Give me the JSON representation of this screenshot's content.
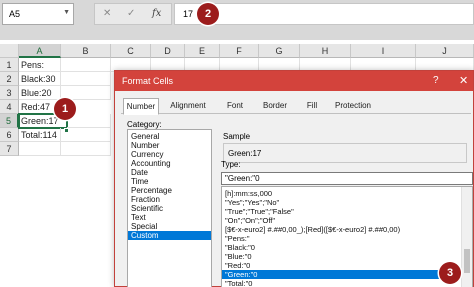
{
  "formula_bar": {
    "name_box": "A5",
    "name_box_arrow": "▼",
    "cancel_icon": "✕",
    "enter_icon": "✓",
    "function_icon": "fx",
    "content": "17"
  },
  "callouts": {
    "one": "1",
    "two": "2",
    "three": "3"
  },
  "sheet": {
    "columns": [
      "A",
      "B",
      "C",
      "D",
      "E",
      "F",
      "G",
      "H",
      "I",
      "J"
    ],
    "rows": [
      "1",
      "2",
      "3",
      "4",
      "5",
      "6",
      "7"
    ],
    "cells_col_a": [
      "Pens:",
      "Black:30",
      "Blue:20",
      "Red:47",
      "Green:17",
      "Total:114",
      ""
    ]
  },
  "dialog": {
    "title": "Format Cells",
    "help_icon": "?",
    "close_icon": "✕",
    "tabs": [
      "Number",
      "Alignment",
      "Font",
      "Border",
      "Fill",
      "Protection"
    ],
    "category_label": "Category:",
    "categories": [
      "General",
      "Number",
      "Currency",
      "Accounting",
      "Date",
      "Time",
      "Percentage",
      "Fraction",
      "Scientific",
      "Text",
      "Special",
      "Custom"
    ],
    "selected_category": "Custom",
    "sample_label": "Sample",
    "sample_value": "Green:17",
    "type_label": "Type:",
    "type_value": "\"Green:\"0",
    "type_list": [
      "[h]:mm:ss,000",
      "\"Yes\";\"Yes\";\"No\"",
      "\"True\";\"True\";\"False\"",
      "\"On\";\"On\";\"Off\"",
      "[$€-x-euro2] #.##0,00_);[Red]([$€-x-euro2] #.##0,00)",
      "\"Pens:\"",
      "\"Black:\"0",
      "\"Blue:\"0",
      "\"Red:\"0",
      "\"Green:\"0",
      "\"Total:\"0"
    ],
    "selected_type_index": 9
  },
  "colors": {
    "excel_green": "#217346",
    "dialog_title_red": "#d3433c",
    "callout_red": "#9c1c1c",
    "selection_blue": "#0078d7"
  }
}
